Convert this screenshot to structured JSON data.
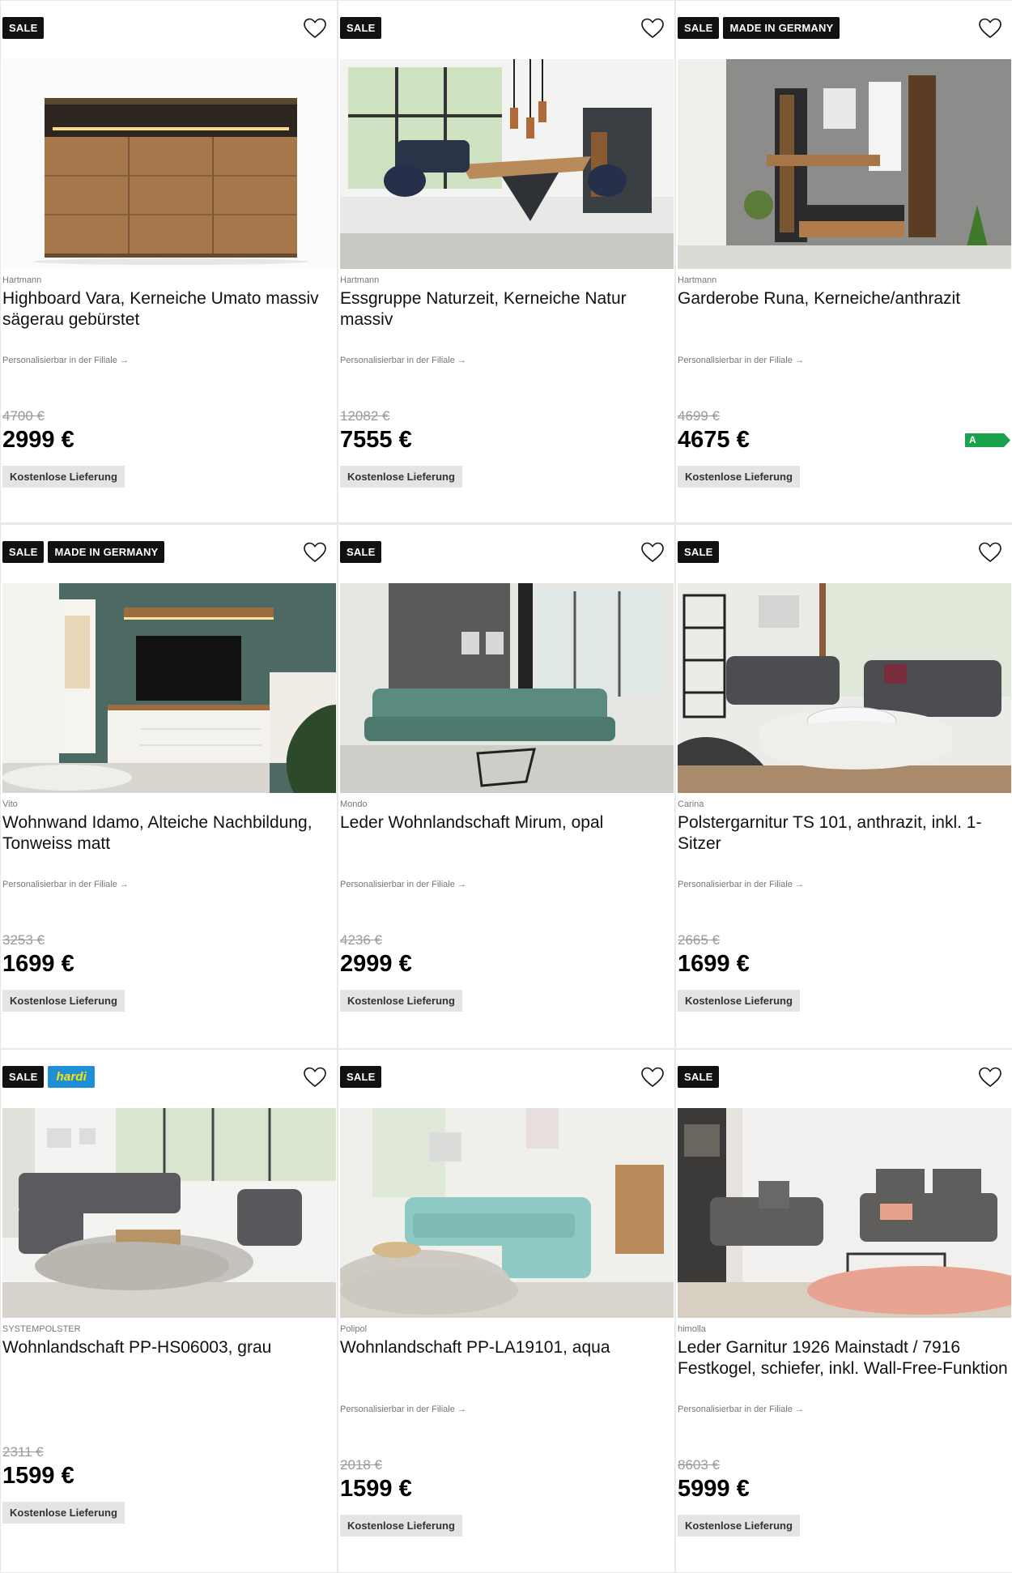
{
  "products": [
    {
      "badges": [
        "SALE"
      ],
      "brand": "Hartmann",
      "title": "Highboard Vara, Kerneiche Umato massiv sägerau gebürstet",
      "personalize": "Personalisierbar in der Filiale →",
      "old_price": "4700 €",
      "price": "2999 €",
      "delivery": "Kostenlose Lieferung",
      "image": "sideboard"
    },
    {
      "badges": [
        "SALE"
      ],
      "brand": "Hartmann",
      "title": "Essgruppe Naturzeit, Kerneiche Natur massiv",
      "personalize": "Personalisierbar in der Filiale →",
      "old_price": "12082 €",
      "price": "7555 €",
      "delivery": "Kostenlose Lieferung",
      "image": "dining"
    },
    {
      "badges": [
        "SALE",
        "MADE IN GERMANY"
      ],
      "brand": "Hartmann",
      "title": "Garderobe Runa, Kerneiche/anthrazit",
      "personalize": "Personalisierbar in der Filiale →",
      "old_price": "4699 €",
      "price": "4675 €",
      "delivery": "Kostenlose Lieferung",
      "energy_label": "A",
      "energy_color": "#1aa34a",
      "image": "wardrobe"
    },
    {
      "badges": [
        "SALE",
        "MADE IN GERMANY"
      ],
      "brand": "Vito",
      "title": "Wohnwand Idamo, Alteiche Nachbildung, Tonweiss matt",
      "personalize": "Personalisierbar in der Filiale →",
      "old_price": "3253 €",
      "price": "1699 €",
      "delivery": "Kostenlose Lieferung",
      "image": "tvwall"
    },
    {
      "badges": [
        "SALE"
      ],
      "brand": "Mondo",
      "title": "Leder Wohnlandschaft Mirum, opal",
      "personalize": "Personalisierbar in der Filiale →",
      "old_price": "4236 €",
      "price": "2999 €",
      "delivery": "Kostenlose Lieferung",
      "image": "greensofa"
    },
    {
      "badges": [
        "SALE"
      ],
      "brand": "Carina",
      "title": "Polstergarnitur TS 101, anthrazit, inkl. 1-Sitzer",
      "personalize": "Personalisierbar in der Filiale →",
      "old_price": "2665 €",
      "price": "1699 €",
      "delivery": "Kostenlose Lieferung",
      "image": "anthracite"
    },
    {
      "badges": [
        "SALE",
        "hardi"
      ],
      "brand": "SYSTEMPOLSTER",
      "title": "Wohnlandschaft PP-HS06003, grau",
      "personalize": "",
      "old_price": "2311 €",
      "price": "1599 €",
      "delivery": "Kostenlose Lieferung",
      "image": "greycorner"
    },
    {
      "badges": [
        "SALE"
      ],
      "brand": "Polipol",
      "title": "Wohnlandschaft PP-LA19101, aqua",
      "personalize": "Personalisierbar in der Filiale →",
      "old_price": "2018 €",
      "price": "1599 €",
      "delivery": "Kostenlose Lieferung",
      "image": "aqua"
    },
    {
      "badges": [
        "SALE"
      ],
      "brand": "himolla",
      "title": "Leder Garnitur 1926 Mainstadt / 7916 Festkogel, schiefer, inkl. Wall-Free-Funktion",
      "personalize": "Personalisierbar in der Filiale →",
      "old_price": "8603 €",
      "price": "5999 €",
      "delivery": "Kostenlose Lieferung",
      "image": "leather"
    }
  ]
}
